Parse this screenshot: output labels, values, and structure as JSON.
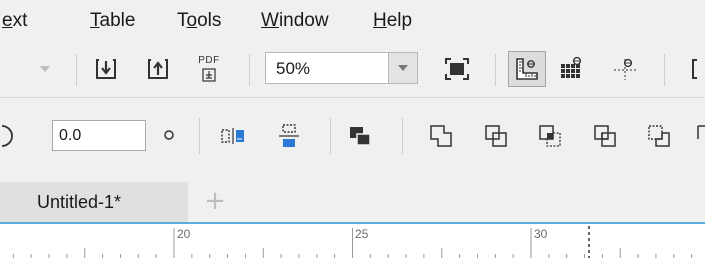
{
  "menu": {
    "items": [
      {
        "label": "ext",
        "mnemonic_index": 0
      },
      {
        "label": "Table",
        "mnemonic_index": 0
      },
      {
        "label": "Tools",
        "mnemonic_index": 1
      },
      {
        "label": "Window",
        "mnemonic_index": 0
      },
      {
        "label": "Help",
        "mnemonic_index": 0
      }
    ]
  },
  "toolbar": {
    "pdf_label": "PDF",
    "zoom_value": "50%"
  },
  "propertybar": {
    "rotation_value": "0.0"
  },
  "document_tabs": {
    "active_tab": "Untitled-1*",
    "add_tab_symbol": "+"
  },
  "ruler": {
    "labels": [
      "20",
      "25",
      "30"
    ]
  },
  "colors": {
    "accent": "#5aaed8",
    "icon_blue": "#2b7bd6",
    "icon_dark": "#333333"
  }
}
